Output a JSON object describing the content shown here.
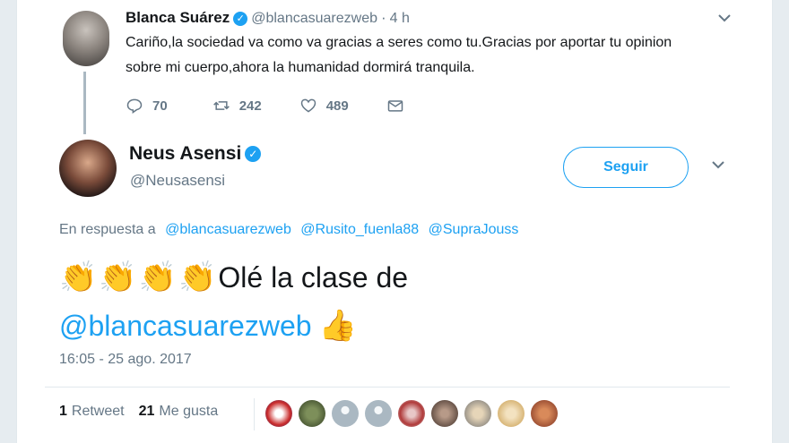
{
  "tweet1": {
    "name": "Blanca Suárez",
    "handle": "@blancasuarezweb",
    "dot": "·",
    "time": "4 h",
    "text": "Cariño,la sociedad va como va gracias a seres como tu.Gracias por aportar tu opinion sobre mi cuerpo,ahora la humanidad dormirá tranquila.",
    "replies": "70",
    "retweets": "242",
    "likes": "489"
  },
  "tweet2": {
    "name": "Neus Asensi",
    "handle": "@Neusasensi",
    "follow_label": "Seguir",
    "reply_prefix": "En respuesta a",
    "reply_mentions": [
      "@blancasuarezweb",
      "@Rusito_fuenla88",
      "@SupraJouss"
    ],
    "claps": [
      "👏",
      "👏",
      "👏",
      "👏"
    ],
    "text": "Olé la clase de",
    "mention": "@blancasuarezweb",
    "thumb": "👍",
    "date": "16:05 - 25 ago. 2017",
    "retweet_count": "1",
    "retweet_label": "Retweet",
    "like_count": "21",
    "like_label": "Me gusta"
  },
  "colors": {
    "accent": "#1da1f2",
    "muted": "#657786",
    "text": "#14171a",
    "background": "#e6ecf0"
  },
  "icons": {
    "verified": "verified-badge-icon",
    "chevron": "chevron-down-icon",
    "reply": "reply-icon",
    "retweet": "retweet-icon",
    "like": "heart-icon",
    "dm": "envelope-icon"
  },
  "likers_count_visible": 9
}
